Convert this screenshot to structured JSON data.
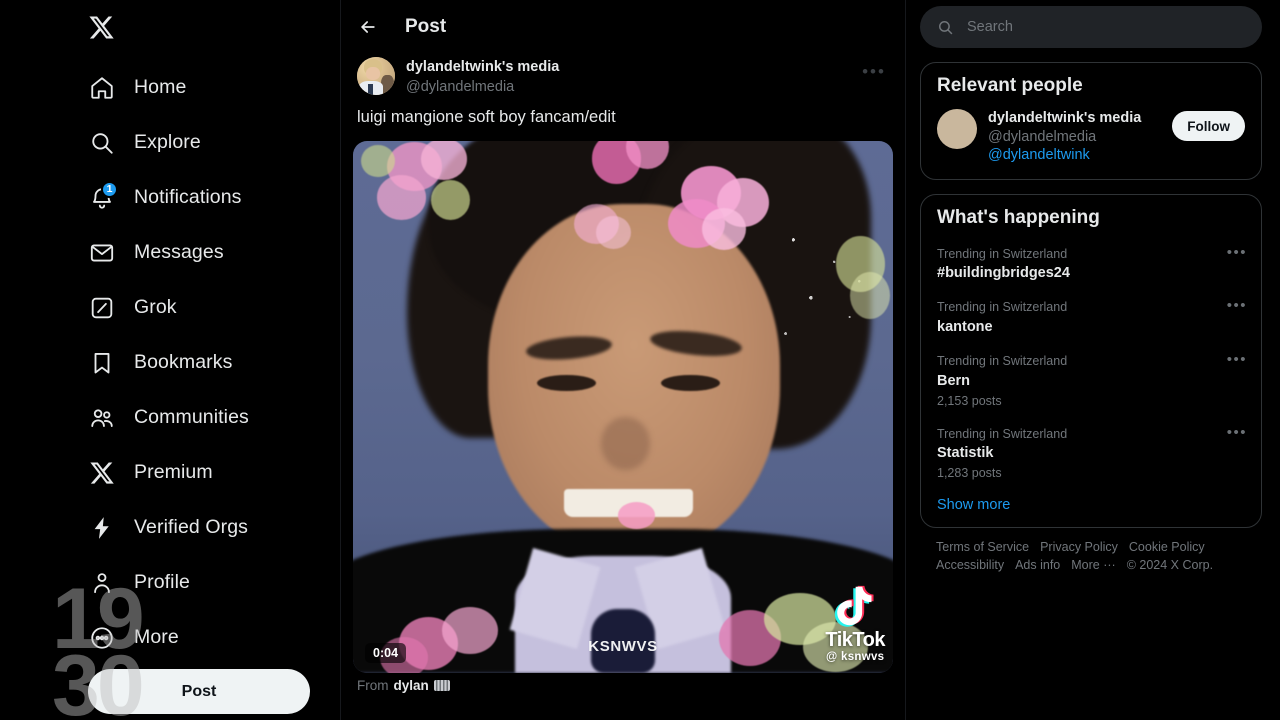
{
  "sidebar": {
    "logo_icon": "x-logo-icon",
    "items": [
      {
        "label": "Home",
        "icon": "home-icon"
      },
      {
        "label": "Explore",
        "icon": "search-icon"
      },
      {
        "label": "Notifications",
        "icon": "bell-icon",
        "badge": "1"
      },
      {
        "label": "Messages",
        "icon": "envelope-icon"
      },
      {
        "label": "Grok",
        "icon": "grok-icon"
      },
      {
        "label": "Bookmarks",
        "icon": "bookmark-icon"
      },
      {
        "label": "Communities",
        "icon": "communities-icon"
      },
      {
        "label": "Premium",
        "icon": "x-premium-icon"
      },
      {
        "label": "Verified Orgs",
        "icon": "lightning-icon"
      },
      {
        "label": "Profile",
        "icon": "person-icon"
      },
      {
        "label": "More",
        "icon": "more-circle-icon"
      }
    ],
    "post_button": "Post",
    "watermark": {
      "line1": "19",
      "line2": "30"
    }
  },
  "center": {
    "back_icon": "back-arrow-icon",
    "title": "Post",
    "author": {
      "display_name": "dylandeltwink's media",
      "handle": "@dylandelmedia",
      "avatar": "author-avatar"
    },
    "more_icon": "more-dots-icon",
    "text": "luigi mangione soft boy fancam/edit",
    "video": {
      "duration": "0:04",
      "watermark": "KSNWVS",
      "platform": "TikTok",
      "platform_handle": "@ ksnwvs"
    },
    "from_label": "From",
    "from_name": "dylan"
  },
  "right": {
    "search": {
      "placeholder": "Search",
      "value": "",
      "icon": "search-icon"
    },
    "relevant_people": {
      "title": "Relevant people",
      "person": {
        "display_name": "dylandeltwink's media",
        "handle": "@dylandelmedia",
        "link": "@dylandeltwink",
        "follow_label": "Follow"
      }
    },
    "whats_happening": {
      "title": "What's happening",
      "trends": [
        {
          "context": "Trending in Switzerland",
          "name": "#buildingbridges24",
          "count": ""
        },
        {
          "context": "Trending in Switzerland",
          "name": "kantone",
          "count": ""
        },
        {
          "context": "Trending in Switzerland",
          "name": "Bern",
          "count": "2,153 posts"
        },
        {
          "context": "Trending in Switzerland",
          "name": "Statistik",
          "count": "1,283 posts"
        }
      ],
      "show_more": "Show more"
    },
    "footer": [
      "Terms of Service",
      "Privacy Policy",
      "Cookie Policy",
      "Accessibility",
      "Ads info",
      "More ···",
      "© 2024 X Corp."
    ]
  },
  "colors": {
    "accent": "#1d9bf0",
    "background": "#000000",
    "text_primary": "#e7e9ea",
    "text_secondary": "#71767b",
    "button_light": "#eff3f4",
    "border": "#2f3336"
  }
}
